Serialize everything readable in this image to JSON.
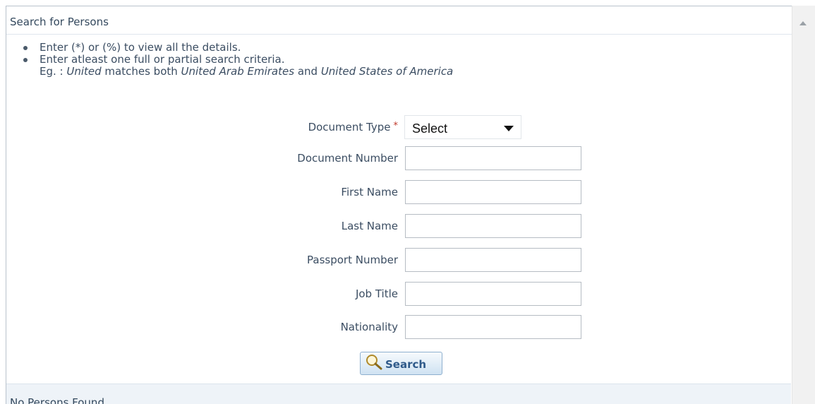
{
  "section": {
    "title": "Search for Persons"
  },
  "instructions": {
    "line1": "Enter (*) or (%) to view all the details.",
    "line2": "Enter atleast one full or partial search criteria.",
    "line3_prefix": "Eg. : ",
    "line3_term": "United",
    "line3_mid": " matches both ",
    "line3_ex1": "United Arab Emirates",
    "line3_and": " and ",
    "line3_ex2": "United States of America"
  },
  "form": {
    "document_type": {
      "label": "Document Type",
      "required_mark": "*",
      "value": "Select"
    },
    "document_number": {
      "label": "Document Number",
      "value": ""
    },
    "first_name": {
      "label": "First Name",
      "value": ""
    },
    "last_name": {
      "label": "Last Name",
      "value": ""
    },
    "passport_number": {
      "label": "Passport Number",
      "value": ""
    },
    "job_title": {
      "label": "Job Title",
      "value": ""
    },
    "nationality": {
      "label": "Nationality",
      "value": ""
    }
  },
  "search_button": {
    "label": "Search",
    "icon": "magnifier-icon"
  },
  "results": {
    "status": "No Persons Found."
  },
  "colors": {
    "accent": "#2f5a8a",
    "required": "#c0392b",
    "footer_bg": "#eef3f8"
  }
}
